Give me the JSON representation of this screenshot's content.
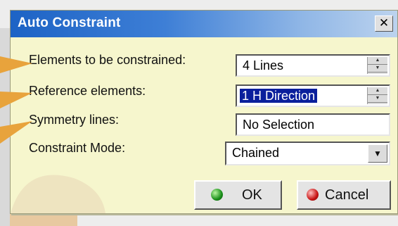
{
  "dialog": {
    "title": "Auto Constraint",
    "close_glyph": "✕"
  },
  "form": {
    "elements_label": "Elements to be constrained:",
    "elements_value": "4 Lines",
    "reference_label": "Reference elements:",
    "reference_value": "1 H Direction",
    "symmetry_label": "Symmetry lines:",
    "symmetry_value": "No Selection",
    "mode_label": "Constraint Mode:",
    "mode_value": "Chained"
  },
  "buttons": {
    "ok_label": "OK",
    "cancel_label": "Cancel",
    "ok_icon": "green-sphere-icon",
    "cancel_icon": "red-sphere-icon"
  },
  "colors": {
    "accent_title": "#1d63c5",
    "dialog_bg": "#f6f6cd",
    "selection": "#0a1f9c",
    "arrow": "#e8a33c"
  }
}
